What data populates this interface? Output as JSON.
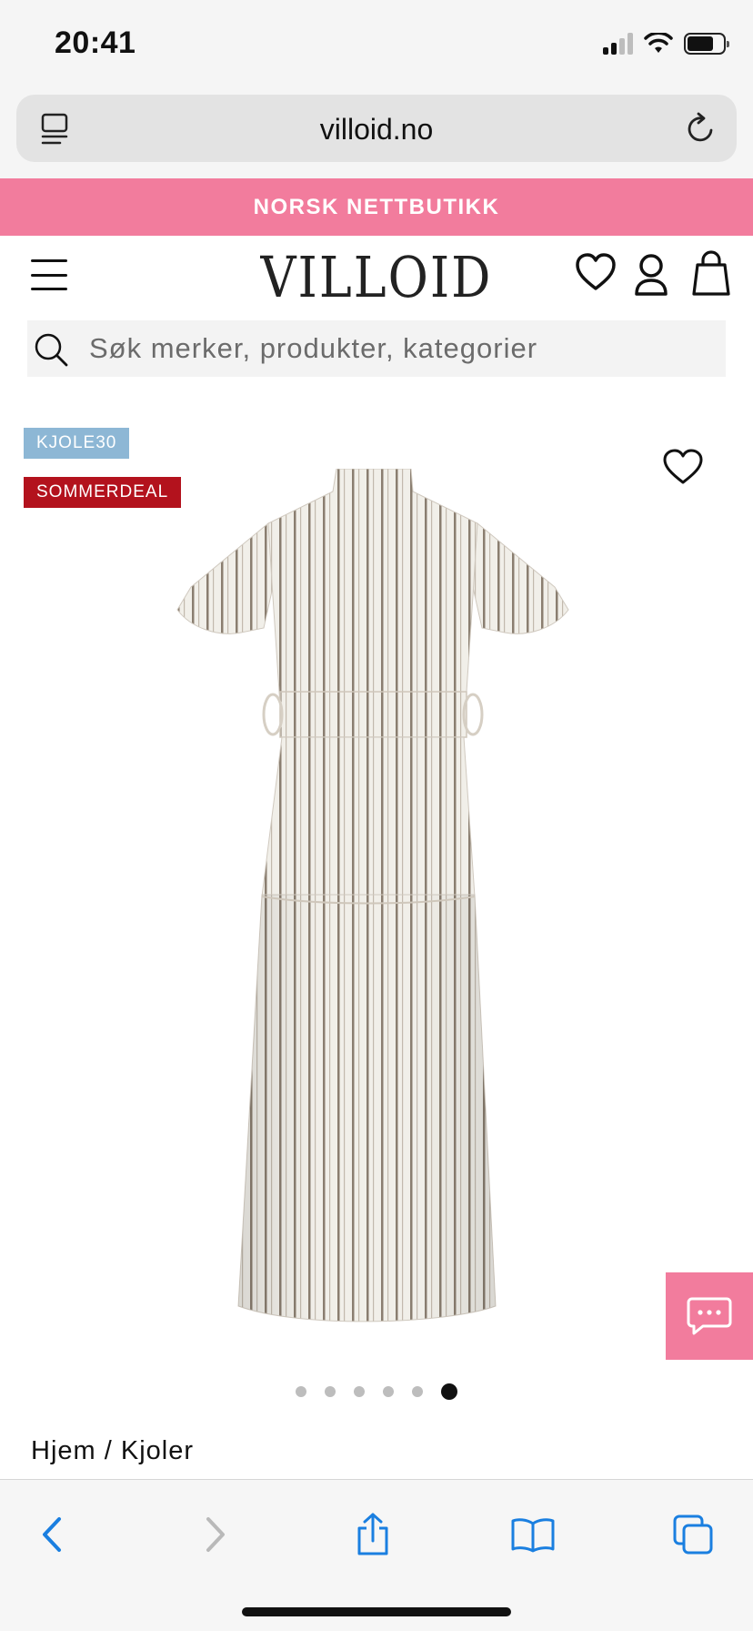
{
  "status_bar": {
    "time": "20:41"
  },
  "browser": {
    "address": "villoid.no",
    "toolbar": {
      "back": "back-icon",
      "forward": "forward-icon",
      "share": "share-icon",
      "bookmarks": "bookmarks-icon",
      "tabs": "tabs-icon"
    }
  },
  "promo_banner": {
    "text": "NORSK NETTBUTIKK"
  },
  "header": {
    "logo": "VILLOID",
    "icons": [
      "menu-icon",
      "heart-icon",
      "account-icon",
      "bag-icon"
    ]
  },
  "search": {
    "placeholder": "Søk merker, produkter, kategorier"
  },
  "product": {
    "badges": {
      "promo_code": "KJOLE30",
      "deal": "SOMMERDEAL"
    },
    "gallery": {
      "slide_count": 6,
      "active_slide": 6
    },
    "breadcrumb": {
      "home": "Hjem",
      "separator": "/",
      "category": "Kjoler"
    }
  },
  "colors": {
    "accent_pink": "#f27c9d",
    "badge_blue": "#8db7d5",
    "badge_red": "#b3121d",
    "ios_blue": "#1a7fe0"
  }
}
